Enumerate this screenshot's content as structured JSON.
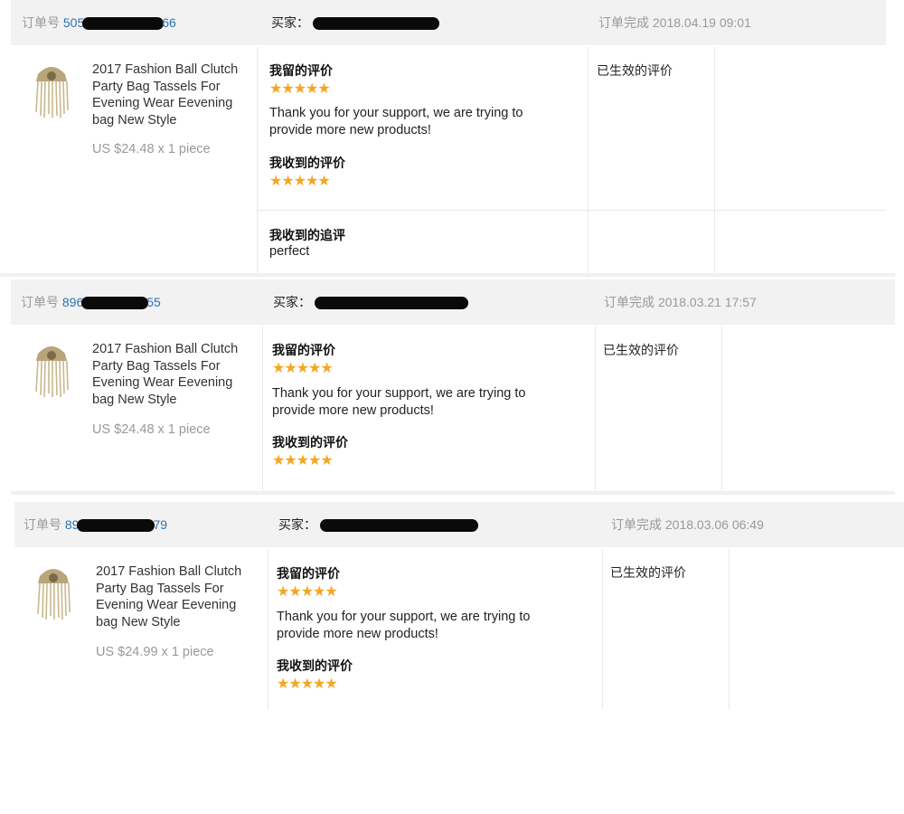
{
  "orders": [
    {
      "order_label": "订单号",
      "order_prefix": "505",
      "order_suffix": "66",
      "buyer_label": "买家：",
      "status_date_label": "订单完成",
      "date": "2018.04.19 09:01",
      "product_title": "2017 Fashion Ball Clutch Party Bag Tassels For Evening Wear Eevening bag New Style",
      "price": "US $24.48 x 1 piece",
      "left_review_label": "我留的评价",
      "left_stars": 5,
      "left_review_text": "Thank you for your support, we are trying to provide more new products!",
      "received_review_label": "我收到的评价",
      "received_stars": 5,
      "followup_label": "我收到的追评",
      "followup_text": "perfect",
      "review_status": "已生效的评价"
    },
    {
      "order_label": "订单号",
      "order_prefix": "896",
      "order_suffix": "55",
      "buyer_label": "买家：",
      "status_date_label": "订单完成",
      "date": "2018.03.21 17:57",
      "product_title": "2017 Fashion Ball Clutch Party Bag Tassels For Evening Wear Eevening bag New Style",
      "price": "US $24.48 x 1 piece",
      "left_review_label": "我留的评价",
      "left_stars": 5,
      "left_review_text": "Thank you for your support, we are trying to provide more new products!",
      "received_review_label": "我收到的评价",
      "received_stars": 5,
      "review_status": "已生效的评价"
    },
    {
      "order_label": "订单号",
      "order_prefix": "89",
      "order_suffix": "79",
      "buyer_label": "买家：",
      "status_date_label": "订单完成",
      "date": "2018.03.06 06:49",
      "product_title": "2017 Fashion Ball Clutch Party Bag Tassels For Evening Wear Eevening bag New Style",
      "price": "US $24.99 x 1 piece",
      "left_review_label": "我留的评价",
      "left_stars": 5,
      "left_review_text": "Thank you for your support, we are trying to provide more new products!",
      "received_review_label": "我收到的评价",
      "received_stars": 5,
      "review_status": "已生效的评价"
    }
  ],
  "icons": {
    "star": "star-icon",
    "product": "tassel-clutch-thumbnail"
  },
  "colors": {
    "header_bg": "#f2f2f2",
    "order_link": "#2b72b8",
    "star": "#f5a623",
    "muted": "#999999"
  }
}
